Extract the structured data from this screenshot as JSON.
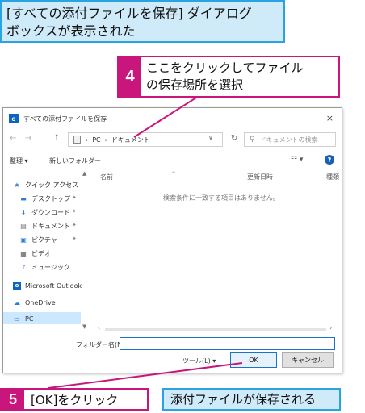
{
  "headline": {
    "line1": "[すべての添付ファイルを保存] ダイアログ",
    "line2": "ボックスが表示された"
  },
  "step4": {
    "number": "4",
    "line1": "ここをクリックしてファイル",
    "line2": "の保存場所を選択"
  },
  "dialog": {
    "title": "すべての添付ファイルを保存",
    "close": "×",
    "app_icon_letter": "o",
    "nav": {
      "back": "←",
      "forward": "→",
      "up": "↑"
    },
    "address": {
      "crumbs": [
        "PC",
        "ドキュメント"
      ],
      "separator": "›",
      "dropdown": "∨",
      "refresh": "↻"
    },
    "search_placeholder": "ドキュメントの検索",
    "toolbar": {
      "organize": "整理 ▾",
      "new_folder": "新しいフォルダー",
      "view": "☷ ▾",
      "help": "?"
    },
    "navpane": {
      "items": [
        {
          "label": "クイック アクセス",
          "icon": "star-icon"
        },
        {
          "label": "デスクトップ",
          "icon": "desktop-icon",
          "pinned": true
        },
        {
          "label": "ダウンロード",
          "icon": "download-icon",
          "pinned": true
        },
        {
          "label": "ドキュメント",
          "icon": "document-icon",
          "pinned": true
        },
        {
          "label": "ピクチャ",
          "icon": "picture-icon",
          "pinned": true
        },
        {
          "label": "ビデオ",
          "icon": "video-icon"
        },
        {
          "label": "ミュージック",
          "icon": "music-icon"
        },
        {
          "label": "Microsoft Outlook",
          "icon": "outlook-icon"
        },
        {
          "label": "OneDrive",
          "icon": "onedrive-icon"
        },
        {
          "label": "PC",
          "icon": "pc-icon",
          "selected": true
        }
      ]
    },
    "columns": {
      "name": "名前",
      "updated": "更新日時",
      "type": "種類"
    },
    "empty_message": "検索条件に一致する項目はありません。",
    "folder_label": "フォルダー名(N):",
    "folder_value": "",
    "tools": "ツール(L)  ▾",
    "ok": "OK",
    "cancel": "キャンセル"
  },
  "step5": {
    "number": "5",
    "text": "[OK]をクリック"
  },
  "result": {
    "text": "添付ファイルが保存される"
  },
  "colors": {
    "magenta": "#c8167c",
    "blue": "#2aa3e0",
    "lightblue": "#cfeaf9"
  }
}
